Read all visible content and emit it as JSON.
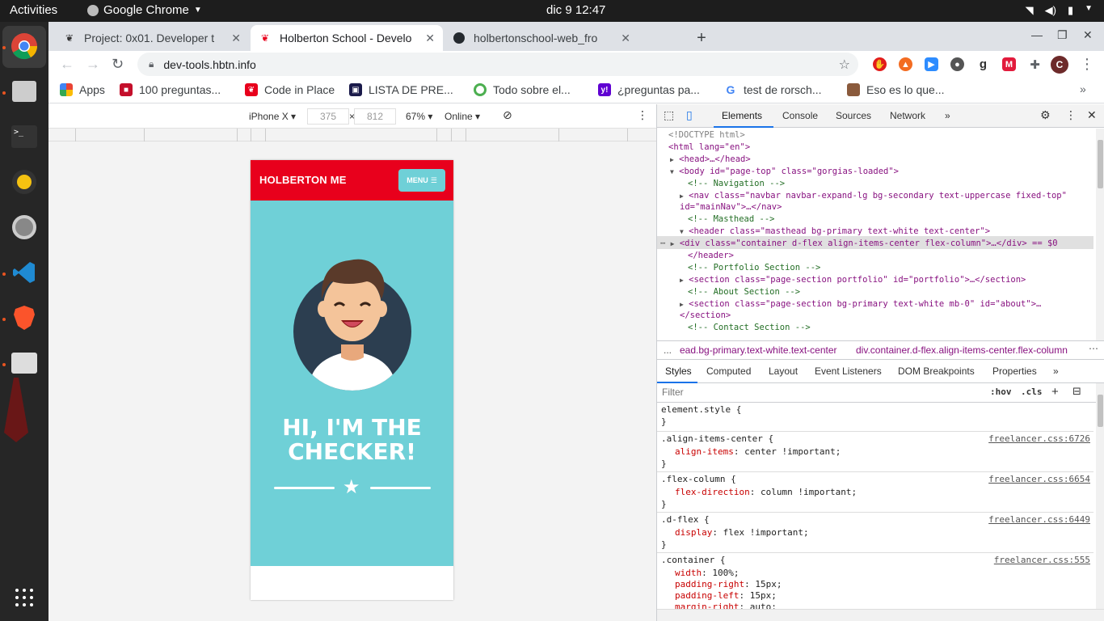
{
  "system": {
    "activities": "Activities",
    "app_name": "Google Chrome",
    "clock": "dic 9  12:47"
  },
  "tabs": [
    {
      "title": "Project: 0x01. Developer t",
      "favicon": "holberton-icon"
    },
    {
      "title": "Holberton School - Develo",
      "favicon": "holberton-icon"
    },
    {
      "title": "holbertonschool-web_fro",
      "favicon": "github-icon"
    }
  ],
  "omnibox": {
    "url": "dev-tools.hbtn.info"
  },
  "extensions": [
    {
      "name": "adblock-icon",
      "color": "#e21b1b"
    },
    {
      "name": "fire-icon",
      "color": "#f36c21"
    },
    {
      "name": "zoom-icon",
      "color": "#2d8cff"
    },
    {
      "name": "ext-icon",
      "color": "#555555"
    },
    {
      "name": "grammarly-icon",
      "color": "#333333"
    },
    {
      "name": "gmail-icon",
      "color": "#e21b3c"
    },
    {
      "name": "puzzle-icon",
      "color": "#5f6368"
    }
  ],
  "profile_initial": "C",
  "bookmarks": [
    {
      "label": "Apps"
    },
    {
      "label": "100 preguntas..."
    },
    {
      "label": "Code in Place"
    },
    {
      "label": "LISTA DE PRE..."
    },
    {
      "label": "Todo sobre el..."
    },
    {
      "label": "¿preguntas pa..."
    },
    {
      "label": "test de rorsch..."
    },
    {
      "label": "Eso es lo que..."
    }
  ],
  "device_toolbar": {
    "device": "iPhone X",
    "width": "375",
    "height": "812",
    "zoom": "67%",
    "network": "Online"
  },
  "page": {
    "brand": "HOLBERTON ME",
    "menu": "MENU",
    "hero_line1": "HI, I'M THE",
    "hero_line2": "CHECKER!",
    "colors": {
      "nav": "#e8001c",
      "masthead": "#6fd0d7"
    }
  },
  "devtools": {
    "tabs": [
      "Elements",
      "Console",
      "Sources",
      "Network"
    ],
    "dom": [
      {
        "type": "doctype",
        "text": "<!DOCTYPE html>"
      },
      {
        "type": "tag",
        "text": "<html lang=\"en\">"
      },
      {
        "type": "tag",
        "text": "<head>…</head>"
      },
      {
        "type": "tag",
        "text": "<body id=\"page-top\" class=\"gorgias-loaded\">"
      },
      {
        "type": "comment",
        "text": "<!-- Navigation -->"
      },
      {
        "type": "tag",
        "text": "<nav class=\"navbar navbar-expand-lg bg-secondary text-uppercase fixed-top\""
      },
      {
        "type": "tag",
        "text": "id=\"mainNav\">…</nav>"
      },
      {
        "type": "comment",
        "text": "<!-- Masthead -->"
      },
      {
        "type": "tag",
        "text": "<header class=\"masthead bg-primary text-white text-center\">"
      },
      {
        "type": "tag",
        "text": "<div class=\"container d-flex align-items-center flex-column\">…</div> == $0"
      },
      {
        "type": "tag",
        "text": "</header>"
      },
      {
        "type": "comment",
        "text": "<!-- Portfolio Section -->"
      },
      {
        "type": "tag",
        "text": "<section class=\"page-section portfolio\" id=\"portfolio\">…</section>"
      },
      {
        "type": "comment",
        "text": "<!-- About Section -->"
      },
      {
        "type": "tag",
        "text": "<section class=\"page-section bg-primary text-white mb-0\" id=\"about\">…"
      },
      {
        "type": "tag",
        "text": "</section>"
      },
      {
        "type": "comment",
        "text": "<!-- Contact Section -->"
      }
    ],
    "breadcrumb": [
      "...",
      "ead.bg-primary.text-white.text-center",
      "div.container.d-flex.align-items-center.flex-column"
    ],
    "subtabs": [
      "Styles",
      "Computed",
      "Layout",
      "Event Listeners",
      "DOM Breakpoints",
      "Properties"
    ],
    "filter_placeholder": "Filter",
    "hov": ":hov",
    "cls": ".cls",
    "rules": [
      {
        "selector": "element.style {",
        "source": "",
        "decls": []
      },
      {
        "selector": ".align-items-center {",
        "source": "freelancer.css:6726",
        "decls": [
          {
            "prop": "align-items",
            "value": "center !important;"
          }
        ]
      },
      {
        "selector": ".flex-column {",
        "source": "freelancer.css:6654",
        "decls": [
          {
            "prop": "flex-direction",
            "value": "column !important;"
          }
        ]
      },
      {
        "selector": ".d-flex {",
        "source": "freelancer.css:6449",
        "decls": [
          {
            "prop": "display",
            "value": "flex !important;"
          }
        ]
      },
      {
        "selector": ".container {",
        "source": "freelancer.css:555",
        "decls": [
          {
            "prop": "width",
            "value": "100%;"
          },
          {
            "prop": "padding-right",
            "value": "15px;"
          },
          {
            "prop": "padding-left",
            "value": "15px;"
          },
          {
            "prop": "margin-right",
            "value": "auto;"
          }
        ]
      }
    ]
  }
}
